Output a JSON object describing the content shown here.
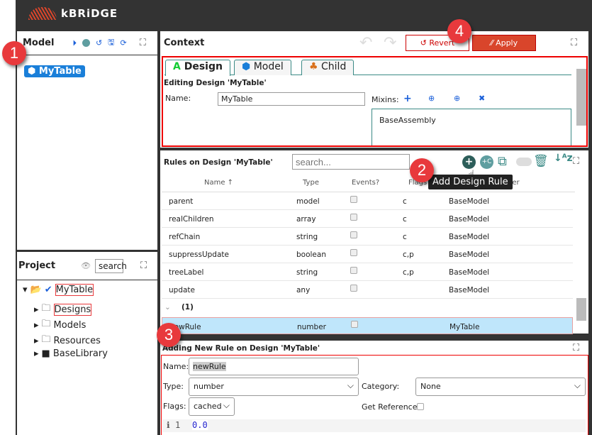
{
  "app": {
    "name": "kBRiDGE"
  },
  "model_panel": {
    "title": "Model",
    "tree_item": "MyTable"
  },
  "project_panel": {
    "title": "Project",
    "search_value": "search",
    "tree": [
      {
        "label": "MyTable"
      },
      {
        "label": "Designs"
      },
      {
        "label": "Models"
      },
      {
        "label": "Resources"
      },
      {
        "label": "BaseLibrary"
      }
    ]
  },
  "context": {
    "title": "Context",
    "revert_label": "Revert",
    "apply_label": "Apply",
    "tabs": [
      {
        "label": "Design"
      },
      {
        "label": "Model"
      },
      {
        "label": "Child"
      }
    ],
    "editing_title": "Editing Design 'MyTable'",
    "name_label": "Name:",
    "name_value": "MyTable",
    "mixins_label": "Mixins:",
    "mixins": [
      "BaseAssembly"
    ]
  },
  "rules": {
    "title": "Rules on Design 'MyTable'",
    "search_placeholder": "search...",
    "tooltip": "Add Design Rule",
    "columns": [
      "Name ↑",
      "Type",
      "Events?",
      "Flags",
      "Owner"
    ],
    "rows": [
      {
        "name": "parent",
        "type": "model",
        "flags": "c",
        "owner": "BaseModel"
      },
      {
        "name": "realChildren",
        "type": "array",
        "flags": "c",
        "owner": "BaseModel"
      },
      {
        "name": "refChain",
        "type": "string",
        "flags": "c",
        "owner": "BaseModel"
      },
      {
        "name": "suppressUpdate",
        "type": "boolean",
        "flags": "c,p",
        "owner": "BaseModel"
      },
      {
        "name": "treeLabel",
        "type": "string",
        "flags": "c,p",
        "owner": "BaseModel"
      },
      {
        "name": "update",
        "type": "any",
        "flags": "",
        "owner": "BaseModel"
      }
    ],
    "group_label": "(1)",
    "selected_row": {
      "name": "newRule",
      "type": "number",
      "flags": "",
      "owner": "MyTable"
    }
  },
  "new_rule": {
    "title": "Adding New Rule on Design 'MyTable'",
    "name_label": "Name:",
    "name_value": "newRule",
    "type_label": "Type:",
    "type_value": "number",
    "category_label": "Category:",
    "category_value": "None",
    "flags_label": "Flags:",
    "flags_value": "cached",
    "get_ref_label": "Get Reference:",
    "code_line": "1",
    "code_value": "0.0"
  },
  "badges": [
    "1",
    "2",
    "3",
    "4"
  ],
  "colors": {
    "accent": "#1a7fd9",
    "apply": "#d9452b",
    "highlight": "#e8393c",
    "teal": "#3b8a86"
  }
}
